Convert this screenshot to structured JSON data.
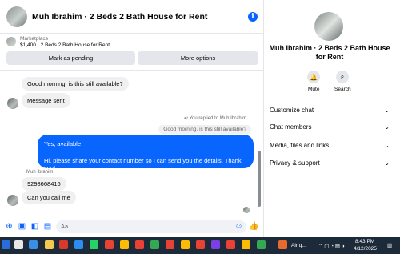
{
  "colors": {
    "accent": "#0866ff",
    "bubble_in": "#f0f0f0",
    "taskbar": "#1c2a3a"
  },
  "header": {
    "title": "Muh Ibrahim · 2 Beds 2 Bath House for Rent",
    "info_icon": "info-icon"
  },
  "marketplace": {
    "label": "Marketplace",
    "item": "$1,400 · 2 Beds 2 Bath House for Rent",
    "mark_pending_label": "Mark as pending",
    "more_options_label": "More options"
  },
  "messages": {
    "m1": "Good morning, is this still available?",
    "m2": "Message sent",
    "reply_meta": "You replied to Muh Ibrahim",
    "quoted": "Good morning, is this still available?",
    "out1": "Yes, available",
    "out2": "Hi, please share your contact number so I can send you the details. Thank you!",
    "sender": "Muh Ibrahim",
    "m3": "9298668416",
    "m4": "Can you call me"
  },
  "composer": {
    "placeholder": "Aa"
  },
  "side": {
    "title": "Muh Ibrahim · 2 Beds 2 Bath House for Rent",
    "mute_label": "Mute",
    "search_label": "Search",
    "rows": [
      "Customize chat",
      "Chat members",
      "Media, files and links",
      "Privacy & support"
    ]
  },
  "taskbar": {
    "weather": "Air q...",
    "time": "8:43 PM",
    "date": "4/12/2025"
  }
}
